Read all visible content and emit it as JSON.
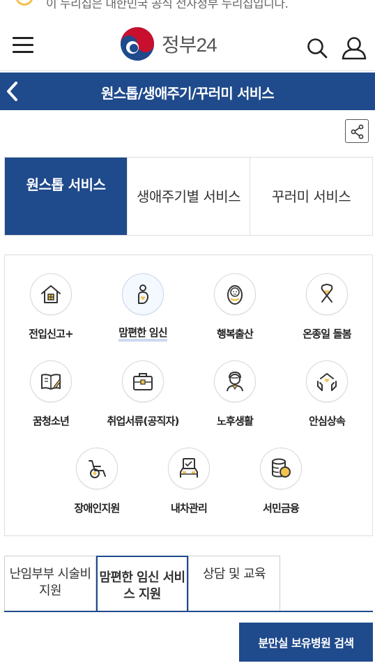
{
  "notice": {
    "text": "이 누리집은 대한민국 공식 전자정부 누리집입니다."
  },
  "header": {
    "logo_text": "정부24",
    "brand_colors": {
      "red": "#c8102e",
      "blue": "#1f4a8c"
    }
  },
  "titlebar": {
    "title": "원스톱/생애주기/꾸러미 서비스",
    "bg_color": "#1f4a8c"
  },
  "main_tabs": [
    {
      "label": "원스톱 서비스",
      "active": true
    },
    {
      "label": "생애주기별 서비스",
      "active": false
    },
    {
      "label": "꾸러미 서비스",
      "active": false
    }
  ],
  "services": [
    {
      "label": "전입신고+",
      "icon": "house-icon"
    },
    {
      "label": "맘편한 임신",
      "icon": "pregnant-icon",
      "active": true
    },
    {
      "label": "행복출산",
      "icon": "baby-icon"
    },
    {
      "label": "온종일 돌봄",
      "icon": "ribbon-icon"
    },
    {
      "label": "꿈청소년",
      "icon": "book-icon"
    },
    {
      "label": "취업서류(공직자)",
      "icon": "briefcase-icon"
    },
    {
      "label": "노후생활",
      "icon": "elderly-icon"
    },
    {
      "label": "안심상속",
      "icon": "hands-icon"
    },
    {
      "label": "장애인지원",
      "icon": "wheelchair-icon"
    },
    {
      "label": "내차관리",
      "icon": "car-icon"
    },
    {
      "label": "서민금융",
      "icon": "coins-icon"
    }
  ],
  "sub_tabs": [
    {
      "label": "난임부부 시술비 지원",
      "active": false
    },
    {
      "label": "맘편한 임신 서비스 지원",
      "active": true
    },
    {
      "label": "상담 및 교육",
      "active": false
    }
  ],
  "search_button": {
    "label": "분만실 보유병원 검색"
  }
}
